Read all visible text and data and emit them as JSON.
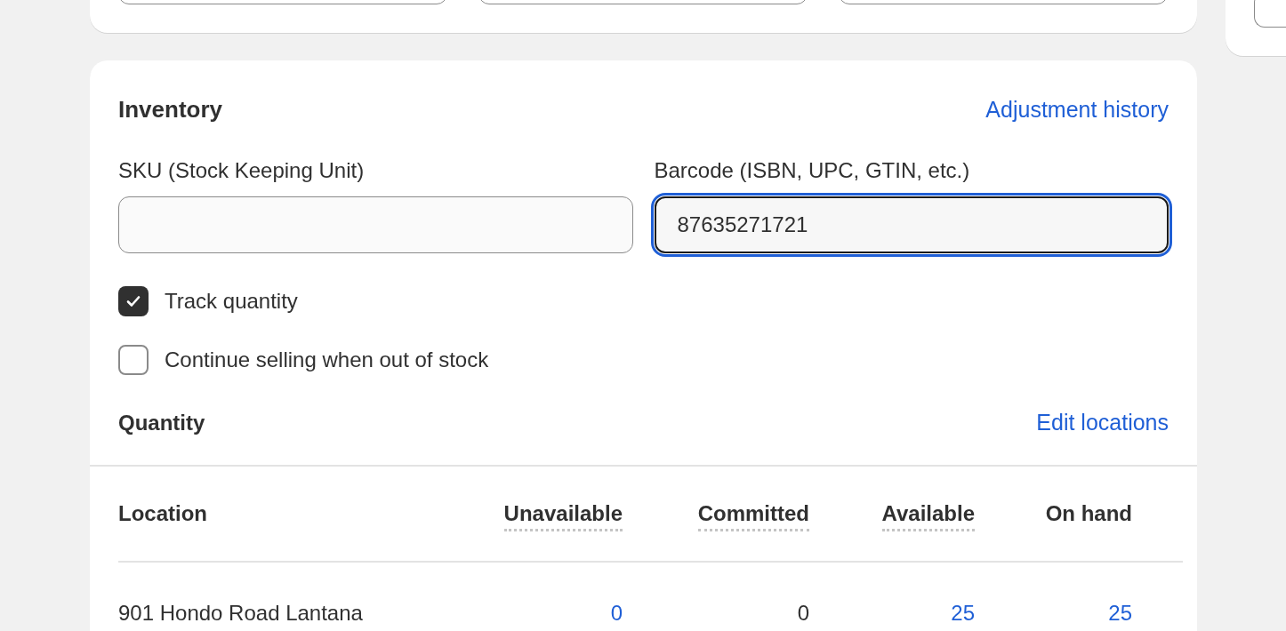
{
  "inventory": {
    "title": "Inventory",
    "history_link": "Adjustment history",
    "fields": [
      {
        "label": "SKU (Stock Keeping Unit)",
        "focused": false
      },
      {
        "label": "Barcode (ISBN, UPC, GTIN, etc.)",
        "value": "87635271721",
        "focused": true
      }
    ],
    "checkboxes": [
      {
        "label": "Track quantity",
        "checked": true
      },
      {
        "label": "Continue selling when out of stock",
        "checked": false
      }
    ],
    "quantity_title": "Quantity",
    "edit_link": "Edit locations",
    "table": {
      "columns": [
        {
          "label": "Location",
          "underlined": false
        },
        {
          "label": "Unavailable",
          "underlined": true
        },
        {
          "label": "Committed",
          "underlined": true
        },
        {
          "label": "Available",
          "underlined": true
        },
        {
          "label": "On hand",
          "underlined": false
        }
      ],
      "rows": [
        {
          "cells": [
            {
              "text": "901 Hondo Road Lantana",
              "link": false
            },
            {
              "text": "0",
              "link": true
            },
            {
              "text": "0",
              "link": false
            },
            {
              "text": "25",
              "link": true
            },
            {
              "text": "25",
              "link": true
            }
          ]
        }
      ]
    }
  }
}
